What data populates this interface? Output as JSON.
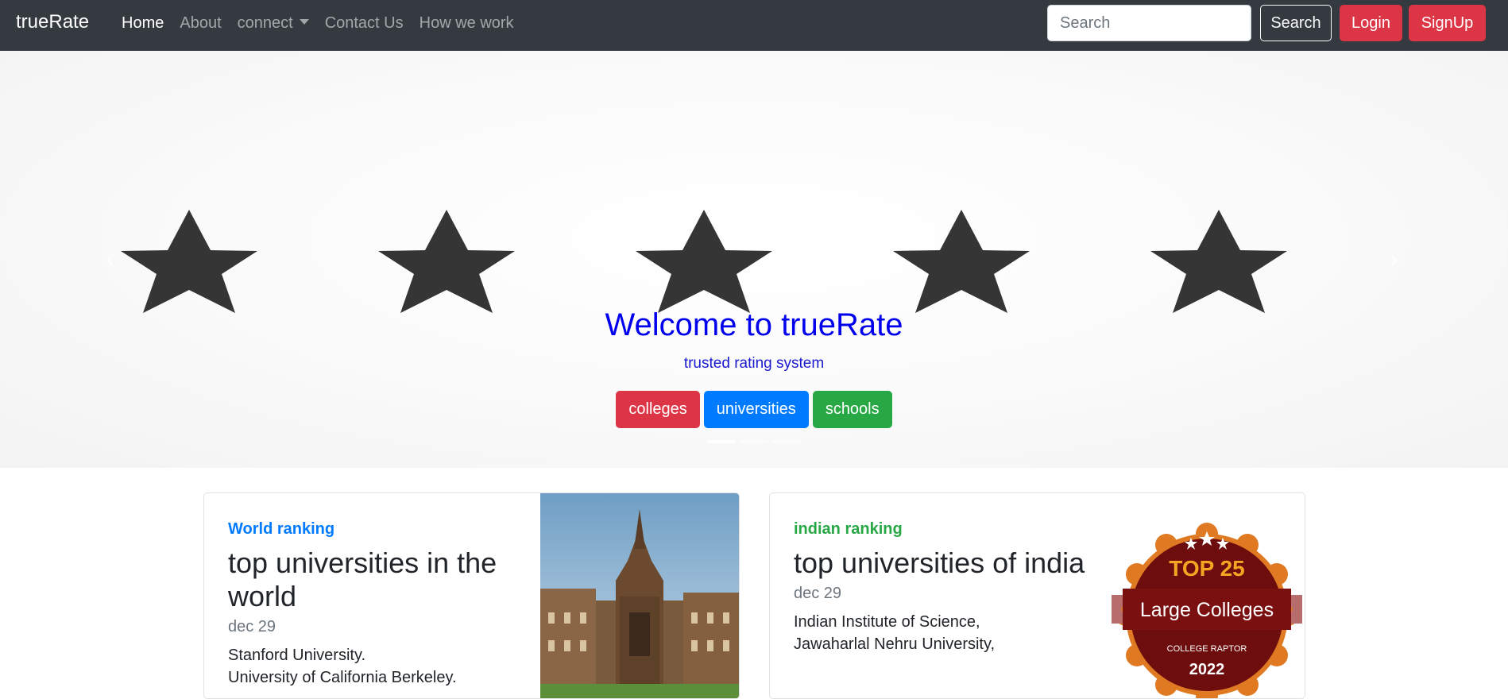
{
  "navbar": {
    "brand": "trueRate",
    "links": [
      {
        "label": "Home"
      },
      {
        "label": "About"
      },
      {
        "label": "connect"
      },
      {
        "label": "Contact Us"
      },
      {
        "label": "How we work"
      }
    ],
    "search_placeholder": "Search",
    "search_button": "Search",
    "login": "Login",
    "signup": "SignUp"
  },
  "hero": {
    "title": "Welcome to trueRate",
    "subtitle": "trusted rating system",
    "buttons": [
      "colleges",
      "universities",
      "schools"
    ],
    "prev_icon": "‹",
    "next_icon": "›",
    "star_color": "#353535",
    "title_color": "#0000ee"
  },
  "cards": [
    {
      "kicker": "World ranking",
      "title": "top universities in the world",
      "date": "dec 29",
      "lines": [
        "Stanford University.",
        "University of California Berkeley."
      ],
      "image": "gothic-university-building-photo"
    },
    {
      "kicker": "indian ranking",
      "title": "top universities of india",
      "date": "dec 29",
      "lines": [
        "Indian Institute of Science,",
        "Jawaharlal Nehru University,"
      ],
      "badge": {
        "top": "TOP 25",
        "main": "Large Colleges",
        "org": "COLLEGE RAPTOR",
        "year": "2022"
      }
    }
  ]
}
